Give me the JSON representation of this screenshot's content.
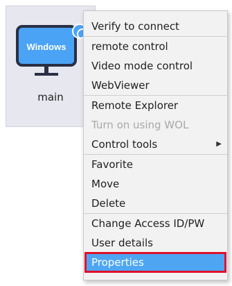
{
  "device": {
    "os_label": "Windows",
    "name": "main"
  },
  "context_menu": {
    "groups": [
      [
        {
          "label": "Verify to connect",
          "enabled": true
        }
      ],
      [
        {
          "label": "remote control",
          "enabled": true
        },
        {
          "label": "Video mode control",
          "enabled": true
        },
        {
          "label": "WebViewer",
          "enabled": true
        }
      ],
      [
        {
          "label": "Remote Explorer",
          "enabled": true
        },
        {
          "label": "Turn on using WOL",
          "enabled": false
        },
        {
          "label": "Control tools",
          "enabled": true,
          "submenu": true
        }
      ],
      [
        {
          "label": "Favorite",
          "enabled": true
        },
        {
          "label": "Move",
          "enabled": true
        },
        {
          "label": "Delete",
          "enabled": true
        }
      ],
      [
        {
          "label": "Change Access ID/PW",
          "enabled": true
        },
        {
          "label": "User details",
          "enabled": true
        },
        {
          "label": "Properties",
          "enabled": true,
          "selected": true
        }
      ]
    ]
  },
  "colors": {
    "monitor_screen": "#4aa3f5",
    "monitor_frame": "#2a2f44",
    "selection": "#4ea6f2",
    "highlight_border": "#e0102b",
    "disabled_text": "#a8a8a8"
  },
  "icons": {
    "device": "monitor-icon",
    "status": "status-badge-icon",
    "submenu": "chevron-right-icon"
  }
}
